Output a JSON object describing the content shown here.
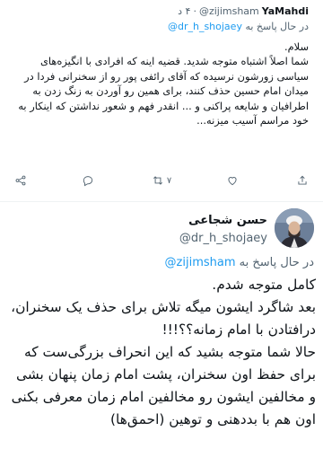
{
  "quoted_tweet": {
    "display_name": "YaMahdi",
    "handle": "@zijimsham",
    "separator": "·",
    "time": "۴ د",
    "replying_prefix": "در حال پاسخ به",
    "replying_to": "@dr_h_shojaey",
    "body": {
      "greeting": "سلام.",
      "text": "شما اصلاً اشتباه متوجه شدید. قضیه اینه که افرادی با انگیزه‌های سیاسی زورشون نرسیده که آقای رائفی پور رو از سخنرانی فردا در میدان امام حسین حذف کنند، برای همین رو آوردن به زنگ زدن به اطرافیان و شایعه پراکنی و ... انقدر فهم و شعور نداشتن که اینکار به خود مراسم آسیب میزنه..."
    },
    "actions": {
      "reply_count": "",
      "retweet_count": "۷",
      "like_count": "",
      "share_label": ""
    }
  },
  "main_tweet": {
    "display_name": "حسن شجاعی",
    "handle": "@dr_h_shojaey",
    "replying_prefix": "در حال پاسخ به",
    "replying_to": "@zijimsham",
    "body": {
      "line1": "کامل متوجه شدم.",
      "line2": "بعد شاگرد ایشون میگه تلاش برای حذف یک سخنران، درافتادن با امام زمانه؟؟!!!",
      "line3": "حالا شما متوجه بشید که این انحراف بزرگی‌ست که برای حفظ اون سخنران، پشت امام زمان پنهان بشی و مخالفین ایشون رو مخالفین امام زمان معرفی بکنی اون هم با بددهنی و توهین (احمق‌ها)"
    }
  },
  "colors": {
    "link": "#1d9bf0",
    "secondary": "#536471",
    "text": "#0f1419"
  },
  "icons": {
    "reply": "reply-icon",
    "retweet": "retweet-icon",
    "like": "heart-icon",
    "share": "share-icon",
    "avatar": "avatar-image"
  }
}
